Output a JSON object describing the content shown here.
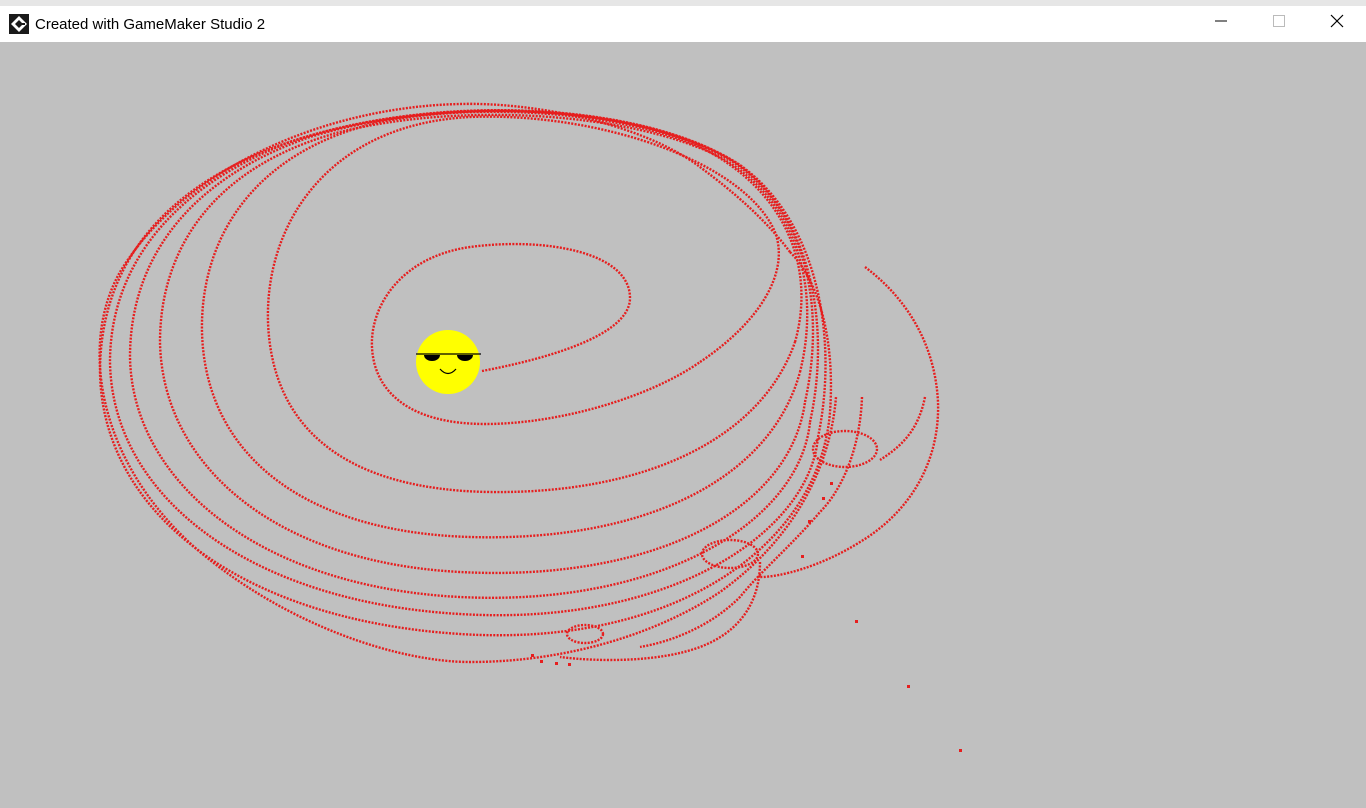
{
  "window": {
    "title": "Created with GameMaker Studio 2",
    "app_icon": "gamemaker-icon",
    "controls": {
      "minimize_icon": "minimize-icon",
      "maximize_icon": "maximize-icon",
      "close_icon": "close-icon"
    }
  },
  "game": {
    "background_color": "#c0c0c0",
    "trail_color": "#e61e1e",
    "player_color": "#ffff00",
    "player_face": "smiley-with-sunglasses",
    "trail_glyph": "orbit-trail-dots"
  }
}
